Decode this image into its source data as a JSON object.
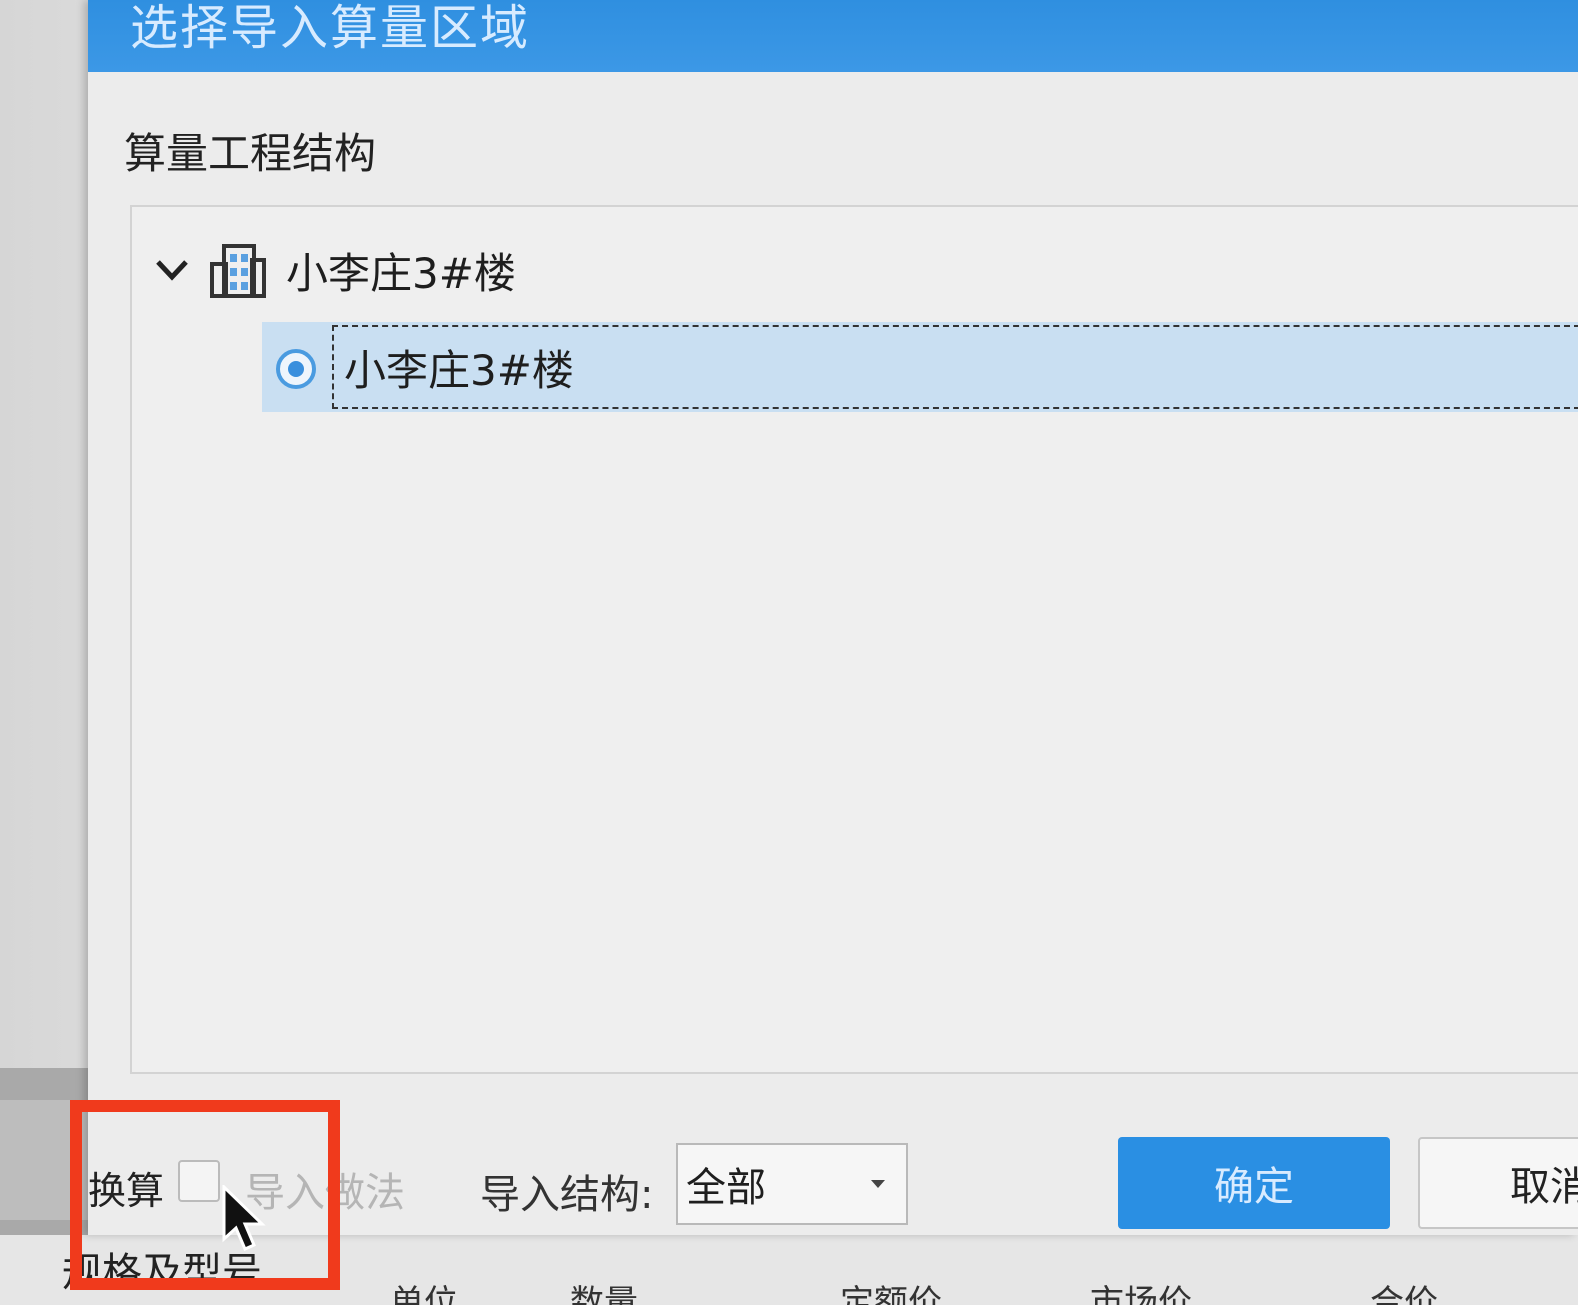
{
  "dialog": {
    "title": "选择导入算量区域",
    "section_label": "算量工程结构",
    "tree": {
      "root": {
        "label": "小李庄3#楼",
        "expanded": true,
        "icon": "building-icon"
      },
      "child": {
        "label": "小李庄3#楼",
        "selected": true,
        "icon": "radio-selected-icon"
      }
    },
    "footer": {
      "import_method_checkbox": {
        "label": "导入做法",
        "checked": false,
        "enabled": false
      },
      "structure_label": "导入结构:",
      "structure_select": {
        "value": "全部"
      },
      "ok_label": "确定",
      "cancel_label": "取消"
    }
  },
  "background": {
    "left_fragment": "换算",
    "bottom_fragment": "规格及型号",
    "columns": [
      "单位",
      "数量",
      "定额价",
      "市场价",
      "合价"
    ]
  },
  "colors": {
    "title_bar": "#2f8fe0",
    "selection": "#c9dff2",
    "primary_button": "#2a8fe3",
    "annotation": "#f03a1c"
  }
}
